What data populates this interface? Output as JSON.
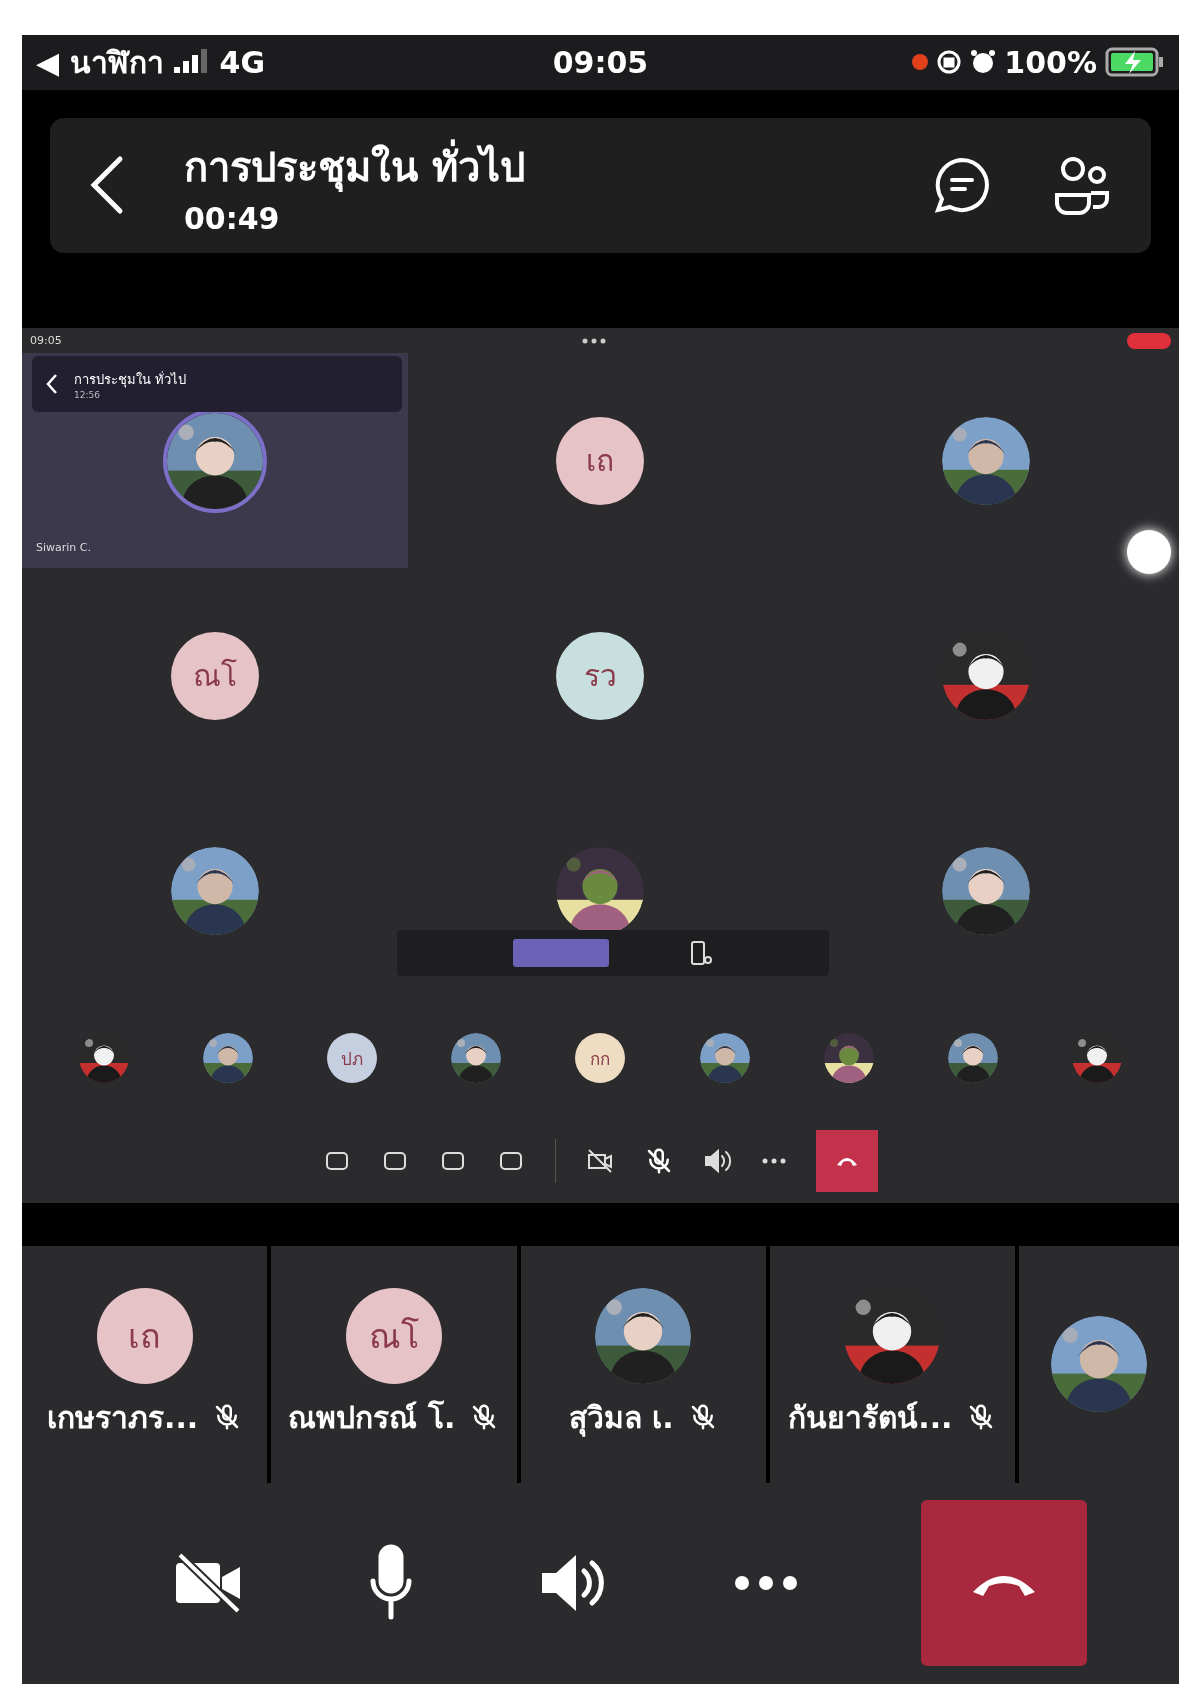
{
  "status_bar": {
    "back_arrow": "◀",
    "back_label": "นาฬิกา",
    "network": "4G",
    "time": "09:05",
    "battery": "100%",
    "recording": true
  },
  "header": {
    "title": "การประชุมใน ทั่วไป",
    "duration": "00:49"
  },
  "shared_screen": {
    "status_time": "09:05",
    "presenter_bar": {
      "title": "การประชุมใน ทั่วไป",
      "time": "12:56"
    },
    "tiles": [
      {
        "kind": "picture",
        "name": "Siwarin C.",
        "highlighted": true
      },
      {
        "kind": "initials",
        "initials": "เถ",
        "color": "#e6c3c7",
        "highlighted": false
      },
      {
        "kind": "picture",
        "highlighted": false
      },
      {
        "kind": "initials",
        "initials": "ณโ",
        "color": "#e6c3c7",
        "highlighted": false
      },
      {
        "kind": "initials",
        "initials": "รว",
        "color": "#c8dfdf",
        "highlighted": false
      },
      {
        "kind": "picture",
        "highlighted": false
      },
      {
        "kind": "picture",
        "highlighted": false
      },
      {
        "kind": "picture",
        "highlighted": false
      },
      {
        "kind": "picture",
        "highlighted": false
      }
    ],
    "strip": [
      {
        "kind": "picture"
      },
      {
        "kind": "picture"
      },
      {
        "kind": "initials",
        "initials": "ปภ",
        "color": "#c6cfdf"
      },
      {
        "kind": "picture"
      },
      {
        "kind": "initials",
        "initials": "กก",
        "color": "#eedcc3"
      },
      {
        "kind": "picture"
      },
      {
        "kind": "picture"
      },
      {
        "kind": "picture"
      },
      {
        "kind": "picture"
      }
    ]
  },
  "participants": [
    {
      "kind": "initials",
      "initials": "เถ",
      "color": "#e6c3c7",
      "name": "เกษราภร...",
      "muted": true
    },
    {
      "kind": "initials",
      "initials": "ณโ",
      "color": "#e6c3c7",
      "name": "ณพปกรณ์ โ.",
      "muted": true
    },
    {
      "kind": "picture",
      "name": "สุวิมล เ.",
      "muted": true
    },
    {
      "kind": "picture",
      "name": "กันยารัตน์...",
      "muted": true
    },
    {
      "kind": "picture"
    }
  ]
}
